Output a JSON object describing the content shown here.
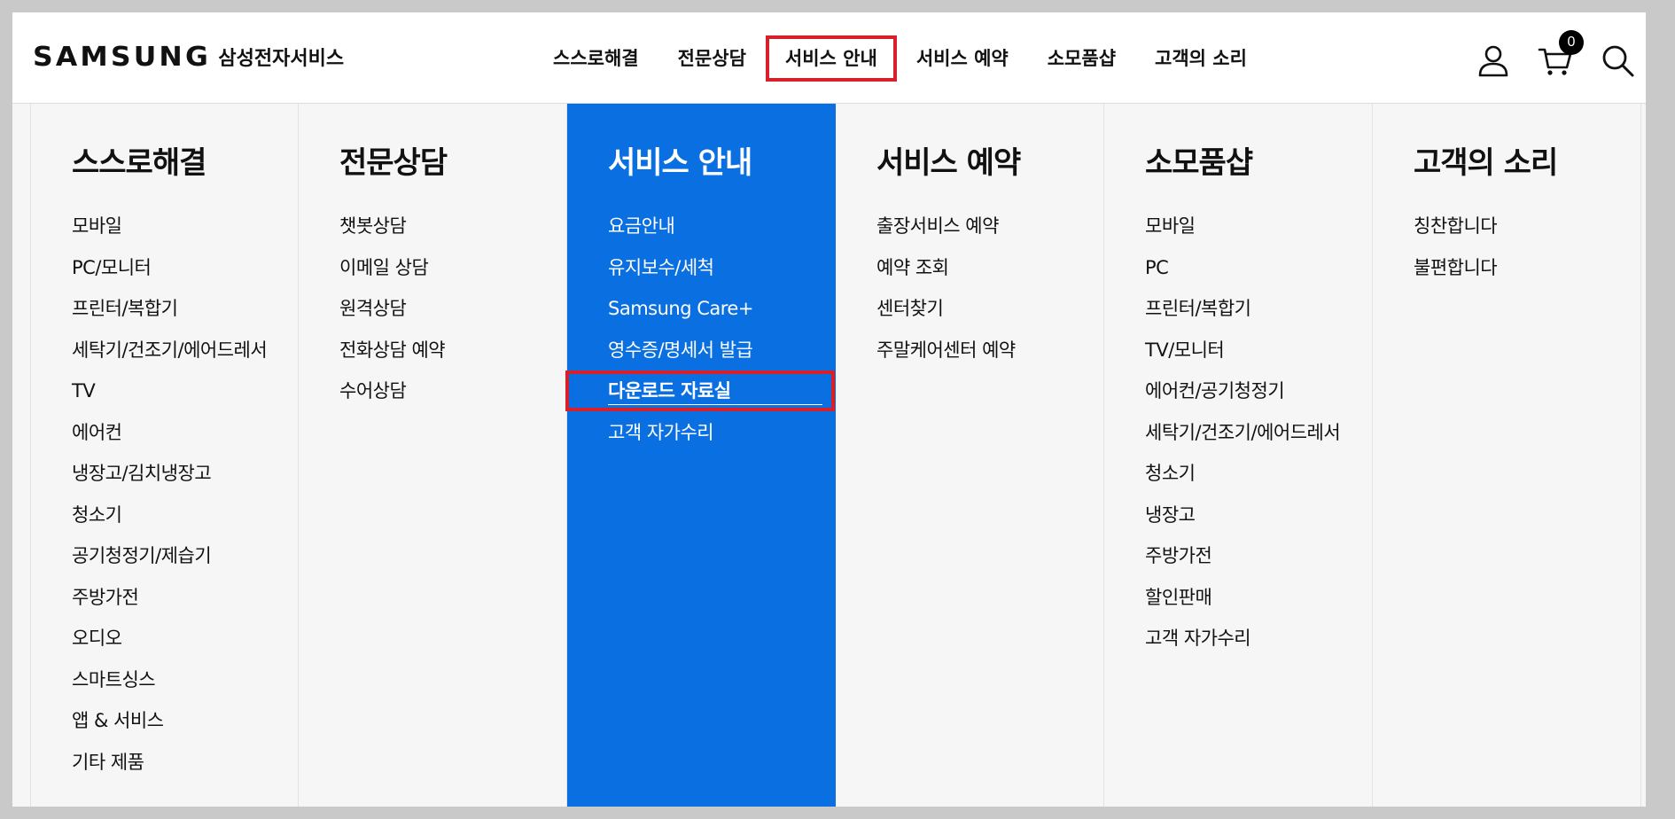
{
  "header": {
    "logo_brand": "SAMSUNG",
    "logo_service": "삼성전자서비스",
    "nav": [
      {
        "label": "스스로해결"
      },
      {
        "label": "전문상담"
      },
      {
        "label": "서비스 안내",
        "active": true
      },
      {
        "label": "서비스 예약"
      },
      {
        "label": "소모품샵"
      },
      {
        "label": "고객의 소리"
      }
    ],
    "utils": {
      "user_icon": "user-icon",
      "cart_icon": "cart-icon",
      "cart_count": "0",
      "search_icon": "search-icon"
    }
  },
  "mega_menu": {
    "columns": [
      {
        "title": "스스로해결",
        "items": [
          "모바일",
          "PC/모니터",
          "프린터/복합기",
          "세탁기/건조기/에어드레서",
          "TV",
          "에어컨",
          "냉장고/김치냉장고",
          "청소기",
          "공기청정기/제습기",
          "주방가전",
          "오디오",
          "스마트싱스",
          "앱 & 서비스",
          "기타 제품"
        ]
      },
      {
        "title": "전문상담",
        "items": [
          "챗봇상담",
          "이메일 상담",
          "원격상담",
          "전화상담 예약",
          "수어상담"
        ]
      },
      {
        "title": "서비스 안내",
        "active": true,
        "items": [
          "요금안내",
          "유지보수/세척",
          "Samsung Care+",
          "영수증/명세서 발급",
          "다운로드 자료실",
          "고객 자가수리"
        ],
        "highlighted_item": "다운로드 자료실"
      },
      {
        "title": "서비스 예약",
        "items": [
          "출장서비스 예약",
          "예약 조회",
          "센터찾기",
          "주말케어센터 예약"
        ]
      },
      {
        "title": "소모품샵",
        "items": [
          "모바일",
          "PC",
          "프린터/복합기",
          "TV/모니터",
          "에어컨/공기청정기",
          "세탁기/건조기/에어드레서",
          "청소기",
          "냉장고",
          "주방가전",
          "할인판매",
          "고객 자가수리"
        ]
      },
      {
        "title": "고객의 소리",
        "items": [
          "칭찬합니다",
          "불편합니다"
        ]
      }
    ]
  },
  "colors": {
    "active_column": "#0a6fe0",
    "highlight_border": "#d7202a",
    "menu_background": "#f6f6f6"
  }
}
